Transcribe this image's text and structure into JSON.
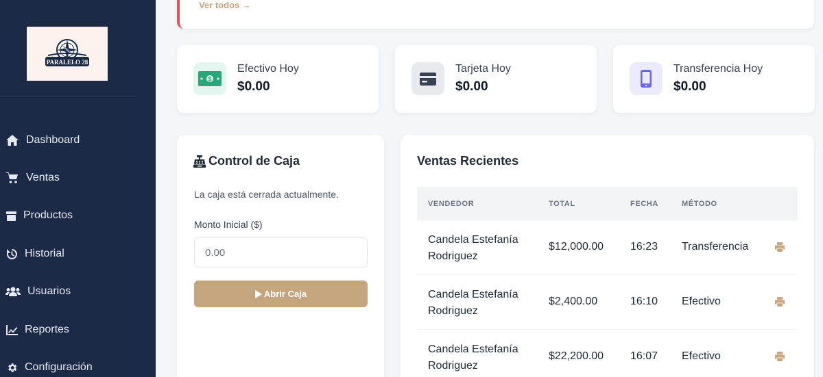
{
  "sidebar": {
    "logo_alt": "Paralelo 28",
    "items": [
      {
        "label": "Dashboard",
        "icon": "home-icon"
      },
      {
        "label": "Ventas",
        "icon": "cart-icon"
      },
      {
        "label": "Productos",
        "icon": "box-icon"
      },
      {
        "label": "Historial",
        "icon": "history-icon"
      },
      {
        "label": "Usuarios",
        "icon": "users-icon"
      },
      {
        "label": "Reportes",
        "icon": "chart-line-icon"
      },
      {
        "label": "Configuración",
        "icon": "gear-icon"
      }
    ]
  },
  "alert": {
    "link": "Ver todos →",
    "accent": "#e0545a"
  },
  "stats": [
    {
      "label": "Efectivo Hoy",
      "value": "$0.00",
      "icon": "money-icon",
      "icon_bg": "#e3f6ef",
      "icon_color": "#28a87a"
    },
    {
      "label": "Tarjeta Hoy",
      "value": "$0.00",
      "icon": "credit-card-icon",
      "icon_bg": "#e9eaee",
      "icon_color": "#374151"
    },
    {
      "label": "Transferencia Hoy",
      "value": "$0.00",
      "icon": "mobile-icon",
      "icon_bg": "#ecebfc",
      "icon_color": "#6b67d8"
    }
  ],
  "caja": {
    "title": "Control de Caja",
    "status": "La caja está cerrada actualmente.",
    "amount_label": "Monto Inicial ($)",
    "amount_placeholder": "0.00",
    "button_label": "Abrir Caja",
    "button_color": "#c4a57e"
  },
  "ventas": {
    "title": "Ventas Recientes",
    "columns": [
      "VENDEDOR",
      "TOTAL",
      "FECHA",
      "MÉTODO"
    ],
    "rows": [
      {
        "vendor_line1": "Candela Estefanía",
        "vendor_line2": "Rodriguez",
        "total": "$12,000.00",
        "fecha": "16:23",
        "metodo": "Transferencia"
      },
      {
        "vendor_line1": "Candela Estefanía",
        "vendor_line2": "Rodriguez",
        "total": "$2,400.00",
        "fecha": "16:10",
        "metodo": "Efectivo"
      },
      {
        "vendor_line1": "Candela Estefanía",
        "vendor_line2": "Rodriguez",
        "total": "$22,200.00",
        "fecha": "16:07",
        "metodo": "Efectivo"
      }
    ]
  }
}
